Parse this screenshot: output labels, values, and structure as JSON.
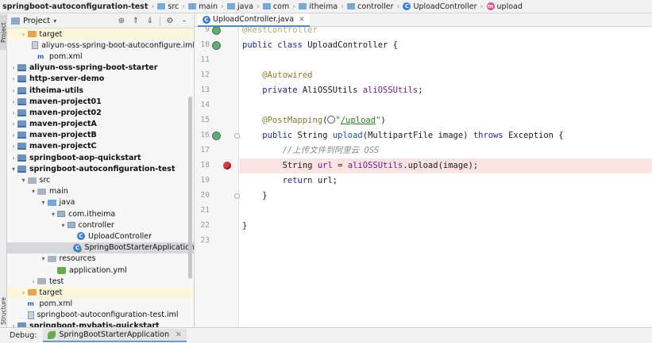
{
  "breadcrumb": [
    {
      "label": "springboot-autoconfiguration-test",
      "kind": "project"
    },
    {
      "label": "src",
      "kind": "folder"
    },
    {
      "label": "main",
      "kind": "folder"
    },
    {
      "label": "java",
      "kind": "folder"
    },
    {
      "label": "com",
      "kind": "package"
    },
    {
      "label": "itheima",
      "kind": "package"
    },
    {
      "label": "controller",
      "kind": "package"
    },
    {
      "label": "UploadController",
      "kind": "class"
    },
    {
      "label": "upload",
      "kind": "method"
    }
  ],
  "side_stripe": {
    "project_label": "Project",
    "structure_label": "Structure"
  },
  "project_panel": {
    "title": "Project",
    "tools": [
      "crosshair-icon",
      "collapse-icon",
      "expand-icon",
      "gear-icon",
      "minimize-icon"
    ],
    "tree": [
      {
        "label": "target",
        "indent": 1,
        "chev": "closed",
        "icon": "folder-orange",
        "bold": false,
        "highlight": "yellow"
      },
      {
        "label": "aliyun-oss-spring-boot-autoconfigure.iml",
        "indent": 2,
        "chev": "",
        "icon": "file-iml",
        "bold": false
      },
      {
        "label": "pom.xml",
        "indent": 2,
        "chev": "",
        "icon": "maven",
        "bold": false
      },
      {
        "label": "aliyun-oss-spring-boot-starter",
        "indent": 0,
        "chev": "closed",
        "icon": "module",
        "bold": true
      },
      {
        "label": "http-server-demo",
        "indent": 0,
        "chev": "closed",
        "icon": "module",
        "bold": true
      },
      {
        "label": "itheima-utils",
        "indent": 0,
        "chev": "closed",
        "icon": "module",
        "bold": true
      },
      {
        "label": "maven-project01",
        "indent": 0,
        "chev": "closed",
        "icon": "module",
        "bold": true
      },
      {
        "label": "maven-project02",
        "indent": 0,
        "chev": "closed",
        "icon": "module",
        "bold": true
      },
      {
        "label": "maven-projectA",
        "indent": 0,
        "chev": "closed",
        "icon": "module",
        "bold": true
      },
      {
        "label": "maven-projectB",
        "indent": 0,
        "chev": "closed",
        "icon": "module",
        "bold": true
      },
      {
        "label": "maven-projectC",
        "indent": 0,
        "chev": "closed",
        "icon": "module",
        "bold": true
      },
      {
        "label": "springboot-aop-quickstart",
        "indent": 0,
        "chev": "closed",
        "icon": "module",
        "bold": true
      },
      {
        "label": "springboot-autoconfiguration-test",
        "indent": 0,
        "chev": "open",
        "icon": "module",
        "bold": true
      },
      {
        "label": "src",
        "indent": 1,
        "chev": "open",
        "icon": "folder-gray",
        "bold": false
      },
      {
        "label": "main",
        "indent": 2,
        "chev": "open",
        "icon": "folder-gray",
        "bold": false
      },
      {
        "label": "java",
        "indent": 3,
        "chev": "open",
        "icon": "folder-blue",
        "bold": false
      },
      {
        "label": "com.itheima",
        "indent": 4,
        "chev": "open",
        "icon": "package",
        "bold": false
      },
      {
        "label": "controller",
        "indent": 5,
        "chev": "open",
        "icon": "package",
        "bold": false
      },
      {
        "label": "UploadController",
        "indent": 6,
        "chev": "",
        "icon": "class",
        "bold": false
      },
      {
        "label": "SpringBootStarterApplication",
        "indent": 6,
        "chev": "",
        "icon": "class-run",
        "bold": false,
        "highlight": "selected"
      },
      {
        "label": "resources",
        "indent": 3,
        "chev": "open",
        "icon": "folder-gray",
        "bold": false
      },
      {
        "label": "application.yml",
        "indent": 4,
        "chev": "",
        "icon": "yml",
        "bold": false
      },
      {
        "label": "test",
        "indent": 2,
        "chev": "closed",
        "icon": "folder-gray",
        "bold": false
      },
      {
        "label": "target",
        "indent": 1,
        "chev": "closed",
        "icon": "folder-orange",
        "bold": false,
        "highlight": "yellow"
      },
      {
        "label": "pom.xml",
        "indent": 1,
        "chev": "",
        "icon": "maven",
        "bold": false
      },
      {
        "label": "springboot-autoconfiguration-test.iml",
        "indent": 1,
        "chev": "",
        "icon": "file-iml",
        "bold": false
      },
      {
        "label": "springboot-mybatis-quickstart",
        "indent": 0,
        "chev": "closed",
        "icon": "module",
        "bold": true
      }
    ]
  },
  "editor": {
    "tab_label": "UploadController.java",
    "lines": [
      {
        "n": "9",
        "segs": [
          [
            "ann-faded",
            "@RestController"
          ]
        ],
        "gutter": "bean"
      },
      {
        "n": "10",
        "segs": [
          [
            "kw",
            "public class "
          ],
          [
            "",
            "UploadController {"
          ]
        ],
        "gutter": "bean"
      },
      {
        "n": "11",
        "segs": []
      },
      {
        "n": "12",
        "segs": [
          [
            "ann",
            "    @Autowired"
          ]
        ]
      },
      {
        "n": "13",
        "segs": [
          [
            "kw",
            "    private "
          ],
          [
            "",
            "AliOSSUtils "
          ],
          [
            "field",
            "aliOSSUtils"
          ],
          [
            "",
            ";"
          ]
        ]
      },
      {
        "n": "14",
        "segs": []
      },
      {
        "n": "15",
        "segs": [
          [
            "ann",
            "    @PostMapping"
          ],
          [
            "",
            "("
          ],
          [
            "web",
            ""
          ],
          [
            "str",
            "\""
          ],
          [
            "str-u",
            "/upload"
          ],
          [
            "str",
            "\""
          ],
          [
            "",
            ")"
          ]
        ]
      },
      {
        "n": "16",
        "segs": [
          [
            "kw",
            "    public "
          ],
          [
            "",
            "String "
          ],
          [
            "meth",
            "upload"
          ],
          [
            "",
            "(MultipartFile image) "
          ],
          [
            "kw",
            "throws "
          ],
          [
            "",
            "Exception {"
          ]
        ],
        "gutter": "bean",
        "fold": true
      },
      {
        "n": "17",
        "segs": [
          [
            "cmt",
            "        //上传文件到阿里云 OSS"
          ]
        ]
      },
      {
        "n": "18",
        "segs": [
          [
            "",
            "        String "
          ],
          [
            "field",
            "url"
          ],
          [
            "",
            " = "
          ],
          [
            "field",
            "aliOSSUtils"
          ],
          [
            "",
            ".upload(image);"
          ]
        ],
        "exec": true,
        "breakpoint": true
      },
      {
        "n": "19",
        "segs": [
          [
            "kw",
            "        return "
          ],
          [
            "",
            "url;"
          ]
        ]
      },
      {
        "n": "20",
        "segs": [
          [
            "",
            "    }"
          ]
        ],
        "fold": true
      },
      {
        "n": "21",
        "segs": []
      },
      {
        "n": "22",
        "segs": [
          [
            "",
            "}"
          ]
        ]
      },
      {
        "n": "23",
        "segs": []
      }
    ]
  },
  "debug_bar": {
    "label": "Debug:",
    "session": "SpringBootStarterApplication"
  }
}
